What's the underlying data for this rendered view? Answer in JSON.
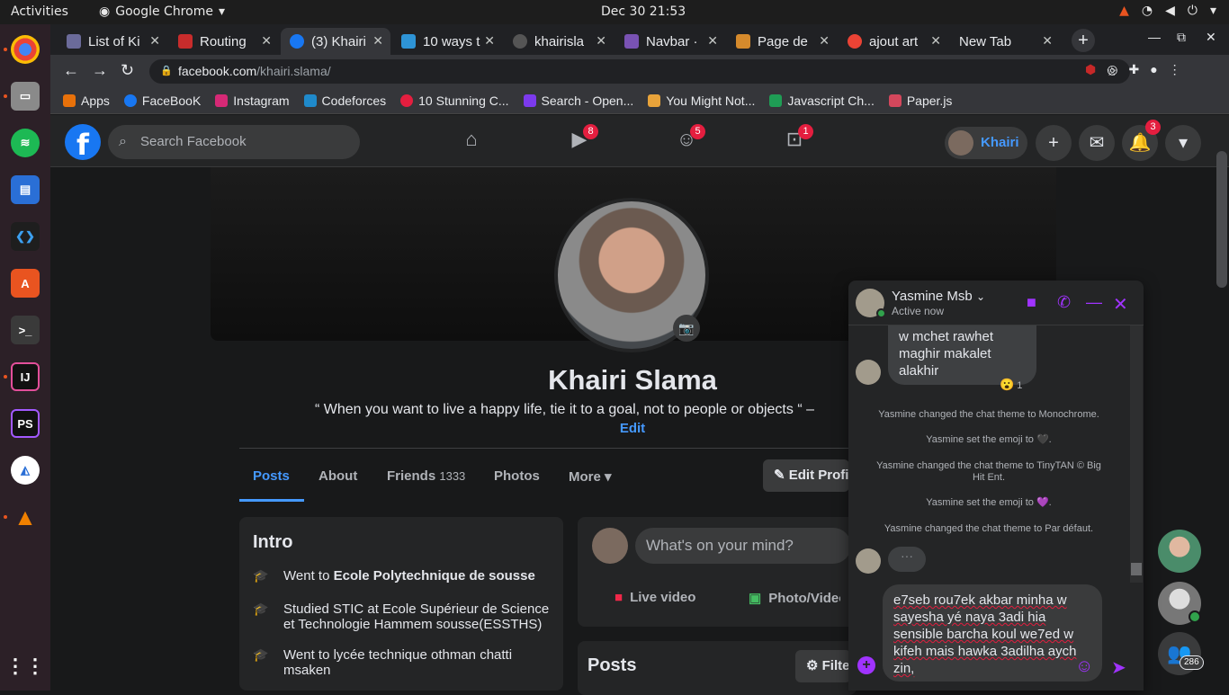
{
  "system": {
    "activities": "Activities",
    "app_name": "Google Chrome",
    "clock": "Dec 30  21:53"
  },
  "tabs": [
    {
      "title": "List of Ki",
      "color": "#6b6b9a"
    },
    {
      "title": "Routing",
      "color": "#c82c2c"
    },
    {
      "title": "(3) Khairi",
      "color": "#1877f2"
    },
    {
      "title": "10 ways t",
      "color": "#2e94d6"
    },
    {
      "title": "khairisla",
      "color": "#555"
    },
    {
      "title": "Navbar ·",
      "color": "#7952b3"
    },
    {
      "title": "Page de",
      "color": "#d58a2c"
    },
    {
      "title": "ajout art",
      "color": "#ea4335"
    },
    {
      "title": "New Tab",
      "color": "#35363a"
    }
  ],
  "url": {
    "domain": "facebook.com",
    "path": "/khairi.slama/"
  },
  "bookmarks": [
    {
      "label": "Apps",
      "color": "#e8710a"
    },
    {
      "label": "FaceBooK",
      "color": "#1877f2"
    },
    {
      "label": "Instagram",
      "color": "#d62976"
    },
    {
      "label": "Codeforces",
      "color": "#1f8acb"
    },
    {
      "label": "10 Stunning C...",
      "color": "#e41e3f"
    },
    {
      "label": "Search - Open...",
      "color": "#7c3aed"
    },
    {
      "label": "You Might Not...",
      "color": "#e8a33a"
    },
    {
      "label": "Javascript Ch...",
      "color": "#1f9d55"
    },
    {
      "label": "Paper.js",
      "color": "#d4475c"
    }
  ],
  "fb": {
    "search_placeholder": "Search Facebook",
    "badges": {
      "watch": "8",
      "groups": "5",
      "gaming": "1",
      "notifications": "3"
    },
    "user_chip": "Khairi",
    "profile": {
      "name": "Khairi Slama",
      "bio": "“ When you want to live a happy life, tie it to a goal, not to people or objects “ –",
      "edit": "Edit"
    },
    "tabs": {
      "posts": "Posts",
      "about": "About",
      "friends": "Friends",
      "friends_count": "1333",
      "photos": "Photos",
      "more": "More"
    },
    "edit_profile": "Edit Profile",
    "intro": {
      "title": "Intro",
      "item1_prefix": "Went to ",
      "item1_school": "Ecole Polytechnique de sousse",
      "item2": "Studied STIC at Ecole Supérieur de Science et Technologie Hammem sousse(ESSTHS)",
      "item3": "Went to lycée technique othman chatti msaken"
    },
    "composer": {
      "placeholder": "What's on your mind?",
      "live": "Live video",
      "photo": "Photo/Video"
    },
    "posts_title": "Posts",
    "filters": "Filters",
    "contacts_count": "286"
  },
  "chat": {
    "name": "Yasmine Msb",
    "status": "Active now",
    "bubble": "w mchet rawhet maghir makalet alakhir",
    "reaction_count": "1",
    "sys1": "Yasmine changed the chat theme to Monochrome.",
    "sys2": "Yasmine set the emoji to 🖤.",
    "sys3": "Yasmine changed the chat theme to TinyTAN © Big Hit Ent.",
    "sys4": "Yasmine set the emoji to 💜.",
    "sys5": "Yasmine changed the chat theme to Par défaut.",
    "draft": "e7seb rou7ek akbar minha w sayesha yé naya 3adi hia sensible barcha koul we7ed w kifeh mais hawka 3adilha aych zin,"
  }
}
